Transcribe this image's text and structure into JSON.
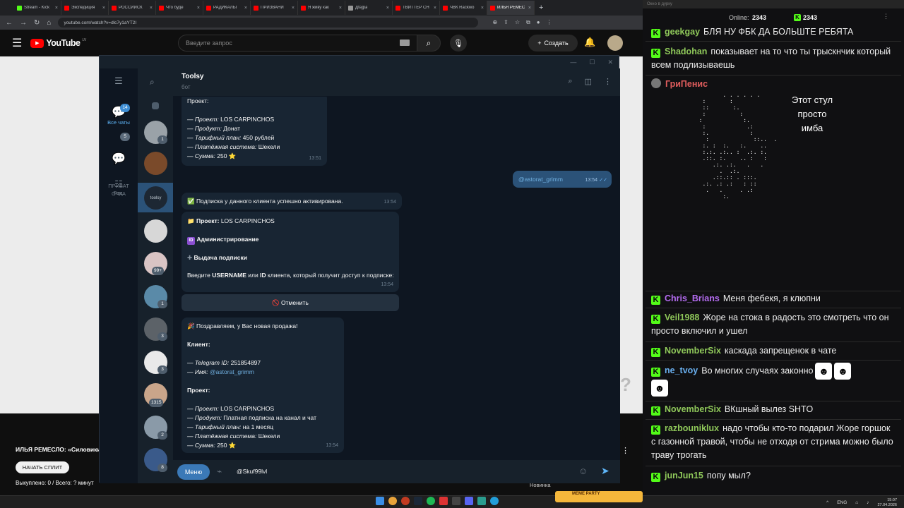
{
  "browser": {
    "tabs": [
      {
        "label": "Stream - Kick",
        "color": "#53fc18",
        "active": false
      },
      {
        "label": "Экспедиция",
        "color": "#ff0000",
        "active": false
      },
      {
        "label": "РОССИЙСК",
        "color": "#ff0000",
        "active": false
      },
      {
        "label": "Что буде",
        "color": "#ff0000",
        "active": false
      },
      {
        "label": "РАДИКАЛЫ",
        "color": "#ff0000",
        "active": false
      },
      {
        "label": "ПРИЗВАНИ",
        "color": "#ff0000",
        "active": false
      },
      {
        "label": "Я живу как",
        "color": "#ff0000",
        "active": false
      },
      {
        "label": "Дfа]ра",
        "color": "#999999",
        "active": false
      },
      {
        "label": "ТВИТТЕР СН",
        "color": "#ff0000",
        "active": false
      },
      {
        "label": "ЧВК Rackwo",
        "color": "#ff0000",
        "active": false
      },
      {
        "label": "ИЛЬЯ РЕМЕС",
        "color": "#ff0000",
        "active": true
      }
    ],
    "url": "youtube.com/watch?v=dlc7y1aYT2I"
  },
  "youtube": {
    "logo": "YouTube",
    "region": "LV",
    "search_placeholder": "Введите запрос",
    "create_label": "Создать",
    "video_title": "ИЛЬЯ РЕМЕСЛО: «Силовики",
    "split_button": "НАЧАТЬ СПЛИТ",
    "bought": "Выкуплено: 0 / Всего: ? минут",
    "news": "Новинка"
  },
  "telegram": {
    "folders": [
      {
        "label": "Все чаты",
        "badge": "14"
      },
      {
        "label": "ПРИВАТ\nОЧКА",
        "badge": "5"
      },
      {
        "label": "Ред.",
        "badge": ""
      }
    ],
    "chat_badges": [
      "1",
      "99+",
      "1",
      "3",
      "3",
      "1315",
      "2",
      "8"
    ],
    "header": {
      "name": "Toolsy",
      "status": "бот"
    },
    "selected_avatar_text": "toolsy",
    "messages": {
      "m1": {
        "heading": "Проект:",
        "lines": [
          {
            "k": "— Проект:",
            "v": "LOS CARPINCHOS"
          },
          {
            "k": "— Продукт:",
            "v": "Донат"
          },
          {
            "k": "— Тарифный план:",
            "v": "450 рублей"
          },
          {
            "k": "— Платёжная система:",
            "v": "Шекели"
          },
          {
            "k": "— Сумма:",
            "v": "250 ⭐"
          }
        ],
        "time": "13:51"
      },
      "out": {
        "text": "@astorat_grimm",
        "time": "13:54"
      },
      "m2": {
        "text": "✅ Подписка у данного клиента успешно активирована.",
        "time": "13:54"
      },
      "m3": {
        "project_label": "Проект:",
        "project_value": "LOS CARPINCHOS",
        "admin": "Администрирование",
        "issue": "Выдача подписки",
        "prompt_1": "Введите ",
        "prompt_username": "USERNAME",
        "prompt_2": " или ",
        "prompt_id": "ID",
        "prompt_3": " клиента, который получит доступ к подписке:",
        "time": "13:54"
      },
      "cancel": "🚫 Отменить",
      "m4": {
        "congrats": "Поздравляем, у Вас новая продажа!",
        "client": "Клиент:",
        "tg_id_k": "— Telegram ID:",
        "tg_id_v": "251854897",
        "name_k": "— Имя:",
        "name_v": "@astorat_grimm",
        "project": "Проект:",
        "lines": [
          {
            "k": "— Проект:",
            "v": "LOS CARPINCHOS"
          },
          {
            "k": "— Продукт:",
            "v": "Платная подписка на канал и чат"
          },
          {
            "k": "— Тарифный план:",
            "v": "на 1 месяц"
          },
          {
            "k": "— Платёжная система:",
            "v": "Шекели"
          },
          {
            "k": "— Сумма:",
            "v": "250 ⭐"
          }
        ],
        "time": "13:54"
      }
    },
    "menu_button": "Меню",
    "input_text": "@Skuf99lvl"
  },
  "chat": {
    "window_title": "Окно в дурку",
    "online_label": "Online:",
    "online_count": "2343",
    "count2": "2343",
    "messages": [
      {
        "user": "geekgay",
        "color": "#8fc85a",
        "text": "БЛЯ НУ ФБК ДА БОЛЬШТЕ РЕБЯТА"
      },
      {
        "user": "Shadohan",
        "color": "#8fc85a",
        "text": "показывает на то что ты трыскнчик который всем подлизываешь"
      },
      {
        "user": "ГриПенис",
        "color": "#e05d5d",
        "text": ""
      },
      {
        "user": "Chris_Brians",
        "color": "#b46cf0",
        "text": "Меня фебекя, я клюпни"
      },
      {
        "user": "Veil1988",
        "color": "#8fc85a",
        "text": "Жоре на стока в радость это смотреть что он просто включил и ушел"
      },
      {
        "user": "NovemberSix",
        "color": "#8fc85a",
        "text": "каскада запрещенок в чате"
      },
      {
        "user": "ne_tvoy",
        "color": "#6ab0f0",
        "text": "Во многих случаях законно"
      },
      {
        "user": "NovemberSix",
        "color": "#8fc85a",
        "text": "ВКшный вылез SHTO"
      },
      {
        "user": "razbouniklux",
        "color": "#8fc85a",
        "text": "надо чтобы кто-то подарил Жоре горшок с газонной травой, чтобы не отходя от стрима можно было траву трогать"
      },
      {
        "user": "junJun15",
        "color": "#8fc85a",
        "text": "попу мыл?"
      }
    ],
    "ascii_side_text": "Этот стул\nпросто\nимба",
    "emote": "☻"
  },
  "taskbar": {
    "game": "MEME PARTY",
    "lang": "ENG",
    "time": "15:07",
    "date": "27.04.2026"
  }
}
